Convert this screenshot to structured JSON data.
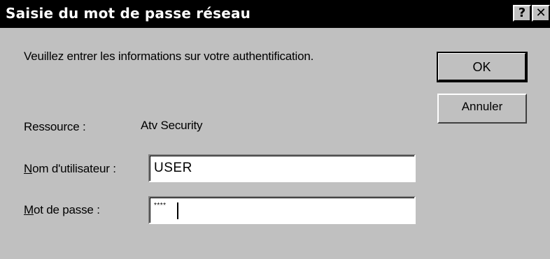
{
  "window": {
    "title": "Saisie du mot de passe réseau",
    "help_label": "?",
    "close_label": "✕"
  },
  "dialog": {
    "instruction": "Veuillez entrer les informations sur votre authentification.",
    "resource_label": "Ressource :",
    "resource_value": "Atv Security",
    "username": {
      "mnemonic": "N",
      "label_rest": "om d'utilisateur :",
      "value": "USER"
    },
    "password": {
      "mnemonic": "M",
      "label_rest": "ot de passe :",
      "value": "****"
    },
    "ok_label": "OK",
    "cancel_label": "Annuler"
  }
}
